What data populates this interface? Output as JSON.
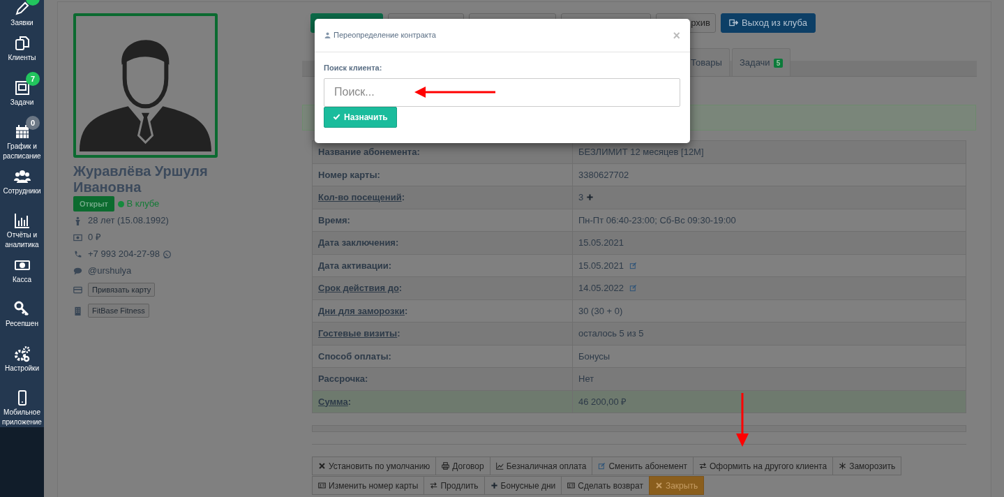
{
  "sidebar": {
    "items": [
      {
        "label": "Заявки",
        "kind": "pencil",
        "color": "#22c55e"
      },
      {
        "label": "Клиенты",
        "kind": "copy"
      },
      {
        "label": "Задачи",
        "kind": "tasks",
        "badge": "7",
        "color": "#22c55e"
      },
      {
        "label": "График и расписание",
        "kind": "calendar",
        "badge": "0",
        "color": "#6b7785"
      },
      {
        "label": "Сотрудники",
        "kind": "people"
      },
      {
        "label": "Отчёты и аналитика",
        "kind": "chart"
      },
      {
        "label": "Касса",
        "kind": "money"
      },
      {
        "label": "Ресепшен",
        "kind": "key"
      },
      {
        "label": "Настройки",
        "kind": "gears"
      },
      {
        "label": "Мобильное приложение",
        "kind": "phone"
      }
    ]
  },
  "profile": {
    "name": "Журавлёва Уршуля Ивановна",
    "status": "Открыт",
    "presence": "В клубе",
    "details": [
      {
        "kind": "person",
        "text": "28 лет (15.08.1992)"
      },
      {
        "kind": "cash",
        "text": "0 ₽"
      },
      {
        "kind": "phone",
        "text": "+7 993 204-27-98"
      },
      {
        "kind": "chat",
        "text": "@urshulya"
      },
      {
        "kind": "card",
        "button": "Привязать карту"
      },
      {
        "kind": "building",
        "button": "FitBase Fitness"
      }
    ]
  },
  "top_buttons": [
    {
      "kind": "success"
    },
    {
      "kind": "default"
    },
    {
      "kind": "default"
    },
    {
      "kind": "default"
    },
    {
      "kind": "default",
      "label": "рхив"
    },
    {
      "kind": "primary",
      "label": "Выход из клуба"
    }
  ],
  "tabs": [
    {
      "label": "Товары",
      "selected": false
    },
    {
      "label": "Задачи",
      "badge": "5",
      "selected": false
    }
  ],
  "contract_table": {
    "rows": [
      {
        "label": "Название абонемента:",
        "value": "БЕЗЛИМИТ 12 месяцев [12M]"
      },
      {
        "label": "Номер карты:",
        "value": "3380627702"
      },
      {
        "label": "Кол-во посещений",
        "link": true,
        "suffix": ":",
        "value": "3",
        "kind": "counter"
      },
      {
        "label": "Время:",
        "value": "Пн-Пт 06:40-23:00; Сб-Вс 09:30-19:00"
      },
      {
        "label": "Дата заключения:",
        "value": "15.05.2021"
      },
      {
        "label": "Дата активации:",
        "value": "15.05.2021",
        "kind": "editable"
      },
      {
        "label": "Срок действия до",
        "link": true,
        "suffix": ":",
        "value": "14.05.2022",
        "kind": "editable"
      },
      {
        "label": "Дни для заморозки",
        "link": true,
        "suffix": ":",
        "value": "30 (30 + 0)"
      },
      {
        "label": "Гостевые визиты",
        "link": true,
        "suffix": ":",
        "value": "осталось 5 из 5"
      },
      {
        "label": "Способ оплаты:",
        "value": "Бонусы"
      },
      {
        "label": "Рассрочка:",
        "value": "Нет"
      },
      {
        "label": "Сумма",
        "link": true,
        "suffix": ":",
        "value": "46 200,00 ₽",
        "kind": "total"
      }
    ]
  },
  "actions": [
    [
      {
        "kind": "reset",
        "label": "Установить по умолчанию"
      },
      {
        "kind": "print",
        "label": "Договор"
      },
      {
        "kind": "payment",
        "label": "Безналичная оплата"
      },
      {
        "kind": "change",
        "label": "Сменить абонемент"
      },
      {
        "kind": "transfer",
        "label": "Оформить на другого клиента"
      },
      {
        "kind": "freeze",
        "label": "Заморозить"
      }
    ],
    [
      {
        "kind": "card",
        "label": "Изменить номер карты"
      },
      {
        "kind": "transfer",
        "label": "Продлить"
      },
      {
        "kind": "bonus",
        "label": "Бонусные дни"
      },
      {
        "kind": "card",
        "label": "Сделать возврат"
      },
      {
        "kind": "close",
        "label": "Закрыть"
      }
    ]
  ],
  "modal": {
    "title": "Переопределение контракта",
    "close": "×",
    "field_label": "Поиск клиента:",
    "placeholder": "Поиск...",
    "submit": "Назначить"
  }
}
